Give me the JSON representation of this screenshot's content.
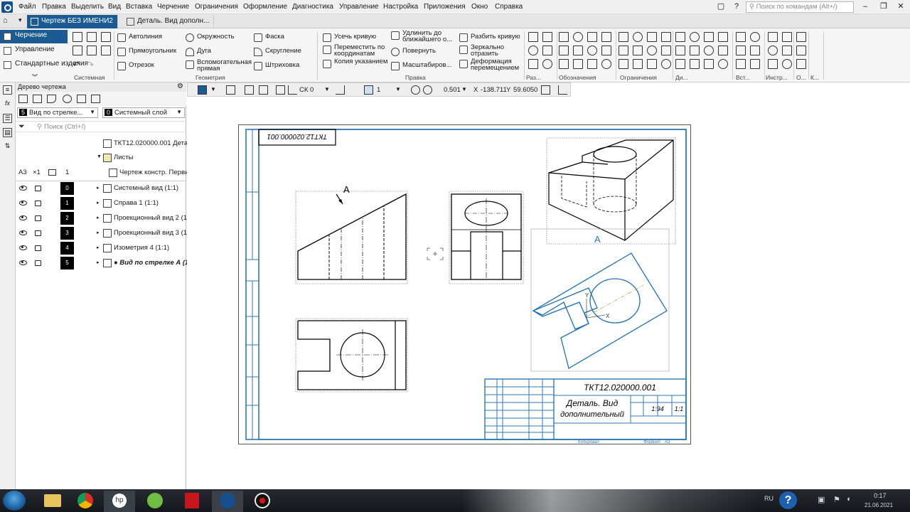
{
  "app": {
    "menu": [
      "Файл",
      "Правка",
      "Выделить",
      "Вид",
      "Вставка",
      "Черчение",
      "Ограничения",
      "Оформление",
      "Диагностика",
      "Управление",
      "Настройка",
      "Приложения",
      "Окно",
      "Справка"
    ],
    "search_placeholder": "Поиск по командам (Alt+/)"
  },
  "tabs": [
    {
      "label": "Чертеж БЕЗ ИМЕНИ2",
      "active": true
    },
    {
      "label": "Деталь. Вид дополн...",
      "active": false
    }
  ],
  "ribbon": {
    "nav": [
      "Черчение",
      "Управление",
      "Стандартные изделия"
    ],
    "nav_group": "Системная",
    "geometry": [
      "Автолиния",
      "Окружность",
      "Фаска",
      "Прямоугольник",
      "Дуга",
      "Скругление",
      "Отрезок",
      "Вспомогательная прямая",
      "Штриховка"
    ],
    "geometry_group": "Геометрия",
    "edit": [
      "Усечь кривую",
      "Удлинить до ближайшего о...",
      "Разбить кривую",
      "Переместить по координатам",
      "Повернуть",
      "Зеркально отразить",
      "Копия указанием",
      "Масштабиров...",
      "Деформация перемещением"
    ],
    "edit_group": "Правка",
    "small_groups": [
      "Раз...",
      "Обозначения",
      "Ограничения",
      "Ди...",
      "Вст...",
      "Инстр...",
      "О...",
      "К..."
    ]
  },
  "tree": {
    "title": "Дерево чертежа",
    "view_combo": {
      "num": "5",
      "label": "Вид по стрелке..."
    },
    "layer_combo": {
      "num": "0",
      "label": "Системный слой"
    },
    "search_placeholder": "Поиск (Ctrl+/)",
    "document": "ТКТ12.020000.001 Детал",
    "sheets": "Листы",
    "format": "А3",
    "scale": "×1",
    "sheet_num": "1",
    "sheet_name": "Чертеж констр. Перви",
    "views": [
      {
        "num": "0",
        "label": "Системный вид (1:1)"
      },
      {
        "num": "1",
        "label": "Справа 1 (1:1)"
      },
      {
        "num": "2",
        "label": "Проекционный вид 2 (1"
      },
      {
        "num": "3",
        "label": "Проекционный вид 3 (1"
      },
      {
        "num": "4",
        "label": "Изометрия 4 (1:1)"
      },
      {
        "num": "5",
        "label": "● Вид по стрелке А (1"
      }
    ]
  },
  "drawbar": {
    "cs": "СК 0",
    "step": "1",
    "zoom": "0.501",
    "x_label": "X",
    "x": "-138.711",
    "y_label": "Y",
    "y": "59.6050"
  },
  "sheet": {
    "designation": "ТКТ12.020000.001",
    "title_line1": "Деталь. Вид",
    "title_line2": "дополнительный",
    "mass": "1:94",
    "scale": "1:1",
    "view_label_a1": "A",
    "view_label_a2": "A",
    "copy_label": "Копировал",
    "format_label": "Формат",
    "format": "A3"
  },
  "taskbar": {
    "lang": "RU",
    "time": "0:17",
    "date": "21.06.2021"
  }
}
